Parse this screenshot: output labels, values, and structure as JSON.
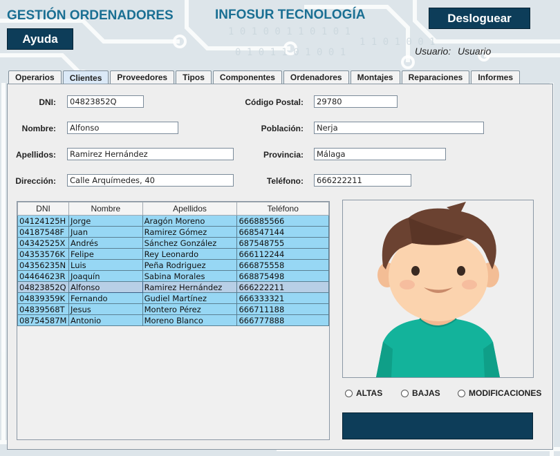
{
  "header": {
    "app_title": "GESTIÓN ORDENADORES",
    "company": "INFOSUR TECNOLOGÍA",
    "logout_label": "Desloguear",
    "help_label": "Ayuda",
    "user_label": "Usuario:",
    "user_name": "Usuario"
  },
  "tabs": [
    "Operarios",
    "Clientes",
    "Proveedores",
    "Tipos",
    "Componentes",
    "Ordenadores",
    "Montajes",
    "Reparaciones",
    "Informes"
  ],
  "active_tab": "Clientes",
  "form": {
    "dni_label": "DNI:",
    "dni": "04823852Q",
    "nombre_label": "Nombre:",
    "nombre": "Alfonso",
    "apellidos_label": "Apellidos:",
    "apellidos": "Ramirez Hernández",
    "direccion_label": "Dirección:",
    "direccion": "Calle Arquímedes, 40",
    "cp_label": "Código Postal:",
    "cp": "29780",
    "poblacion_label": "Población:",
    "poblacion": "Nerja",
    "provincia_label": "Provincia:",
    "provincia": "Málaga",
    "telefono_label": "Teléfono:",
    "telefono": "666222211"
  },
  "table": {
    "headers": [
      "DNI",
      "Nombre",
      "Apellidos",
      "Teléfono"
    ],
    "rows": [
      [
        "04124125H",
        "Jorge",
        "Aragón Moreno",
        "666885566"
      ],
      [
        "04187548F",
        "Juan",
        "Ramirez Gómez",
        "668547144"
      ],
      [
        "04342525X",
        "Andrés",
        "Sánchez González",
        "687548755"
      ],
      [
        "04353576K",
        "Felipe",
        "Rey Leonardo",
        "666112244"
      ],
      [
        "04356235N",
        "Luis",
        "Peña Rodriguez",
        "666875558"
      ],
      [
        "04464623R",
        "Joaquín",
        "Sabina Morales",
        "668875498"
      ],
      [
        "04823852Q",
        "Alfonso",
        "Ramirez Hernández",
        "666222211"
      ],
      [
        "04839359K",
        "Fernando",
        "Gudiel Martínez",
        "666333321"
      ],
      [
        "04839568T",
        "Jesus",
        "Montero Pérez",
        "666711188"
      ],
      [
        "08754587M",
        "Antonio",
        "Moreno Blanco",
        "666777888"
      ]
    ],
    "selected_row": 6
  },
  "radios": {
    "altas": "ALTAS",
    "bajas": "BAJAS",
    "modificaciones": "MODIFICACIONES"
  },
  "colors": {
    "accent_dark": "#0d3d59",
    "title_blue": "#1a6f93",
    "row_blue": "#97d7f4"
  },
  "icons": {
    "avatar": "boy-avatar-icon"
  }
}
